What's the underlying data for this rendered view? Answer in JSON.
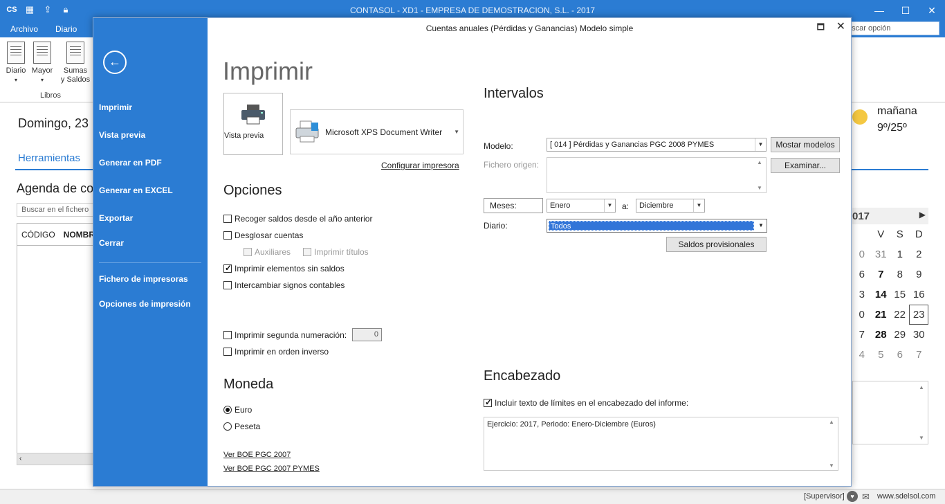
{
  "app": {
    "title": "CONTASOL - XD1 - EMPRESA DE DEMOSTRACION, S.L. - 2017",
    "quick_logo": "CS",
    "tabs": [
      "Archivo",
      "Diario"
    ],
    "search_placeholder": "uscar opción",
    "ribbon": {
      "buttons": [
        {
          "label": "Diario"
        },
        {
          "label": "Mayor"
        },
        {
          "label1": "Sumas",
          "label2": "y Saldos"
        }
      ],
      "group_label": "Libros"
    }
  },
  "background": {
    "date": "Domingo, 23",
    "tools_tab": "Herramientas",
    "agenda": "Agenda de co",
    "search_placeholder": "Buscar en el fichero",
    "grid_headers": [
      "CÓDIGO",
      "NOMBRE"
    ],
    "weather": {
      "day": "mañana",
      "temp": "9º/25º"
    },
    "calendar": {
      "year": "017",
      "weekdays": [
        "",
        "V",
        "S",
        "D"
      ],
      "rows": [
        [
          {
            "d": "0",
            "c": "dim"
          },
          {
            "d": "31",
            "c": "dim"
          },
          {
            "d": "1",
            "c": ""
          },
          {
            "d": "2",
            "c": ""
          }
        ],
        [
          {
            "d": "6",
            "c": ""
          },
          {
            "d": "7",
            "c": "bold"
          },
          {
            "d": "8",
            "c": ""
          },
          {
            "d": "9",
            "c": ""
          }
        ],
        [
          {
            "d": "3",
            "c": ""
          },
          {
            "d": "14",
            "c": "bold"
          },
          {
            "d": "15",
            "c": ""
          },
          {
            "d": "16",
            "c": ""
          }
        ],
        [
          {
            "d": "0",
            "c": ""
          },
          {
            "d": "21",
            "c": "bold"
          },
          {
            "d": "22",
            "c": ""
          },
          {
            "d": "23",
            "c": "today"
          }
        ],
        [
          {
            "d": "7",
            "c": ""
          },
          {
            "d": "28",
            "c": "bold"
          },
          {
            "d": "29",
            "c": ""
          },
          {
            "d": "30",
            "c": ""
          }
        ],
        [
          {
            "d": "4",
            "c": "dim"
          },
          {
            "d": "5",
            "c": "dim"
          },
          {
            "d": "6",
            "c": "dim"
          },
          {
            "d": "7",
            "c": "dim"
          }
        ]
      ]
    }
  },
  "status": {
    "user": "[Supervisor]",
    "web": "www.sdelsol.com"
  },
  "dialog": {
    "title": "Cuentas anuales (Pérdidas y Ganancias) Modelo simple",
    "side_menu": {
      "items": [
        "Imprimir",
        "Vista previa",
        "Generar en PDF",
        "Generar en EXCEL",
        "Exportar",
        "Cerrar"
      ],
      "items2": [
        "Fichero de impresoras",
        "Opciones de impresión"
      ]
    },
    "heading": "Imprimir",
    "preview_button": "Vista previa",
    "printer": "Microsoft XPS Document Writer",
    "config_link": "Configurar impresora",
    "options": {
      "title": "Opciones",
      "recoger": {
        "label": "Recoger saldos desde el año anterior",
        "checked": false
      },
      "desglosar": {
        "label": "Desglosar cuentas",
        "checked": false
      },
      "auxiliares": {
        "label": "Auxiliares",
        "checked": false
      },
      "titulos": {
        "label": "Imprimir títulos",
        "checked": false
      },
      "sin_saldos": {
        "label": "Imprimir elementos sin saldos",
        "checked": true
      },
      "intercambiar": {
        "label": "Intercambiar signos contables",
        "checked": false
      },
      "segunda": {
        "label": "Imprimir segunda numeración:",
        "checked": false,
        "value": "0"
      },
      "inverso": {
        "label": "Imprimir en orden inverso",
        "checked": false
      }
    },
    "currency": {
      "title": "Moneda",
      "euro": "Euro",
      "peseta": "Peseta",
      "selected": "Euro"
    },
    "links": [
      "Ver BOE PGC 2007",
      "Ver BOE PGC 2007 PYMES"
    ],
    "intervals": {
      "title": "Intervalos",
      "modelo_label": "Modelo:",
      "modelo_value": "[ 014 ] Pérdidas y Ganancias PGC 2008 PYMES",
      "mostrar_button": "Mostar modelos",
      "fichero_label": "Fichero origen:",
      "examinar_button": "Examinar...",
      "meses_label": "Meses:",
      "mes_desde": "Enero",
      "a_label": "a:",
      "mes_hasta": "Diciembre",
      "diario_label": "Diario:",
      "diario_value": "Todos",
      "saldos_button": "Saldos provisionales"
    },
    "header": {
      "title": "Encabezado",
      "include_label": "Incluir texto de límites en el encabezado del informe:",
      "include_checked": true,
      "text": "Ejercicio: 2017, Periodo: Enero-Diciembre (Euros)"
    }
  }
}
